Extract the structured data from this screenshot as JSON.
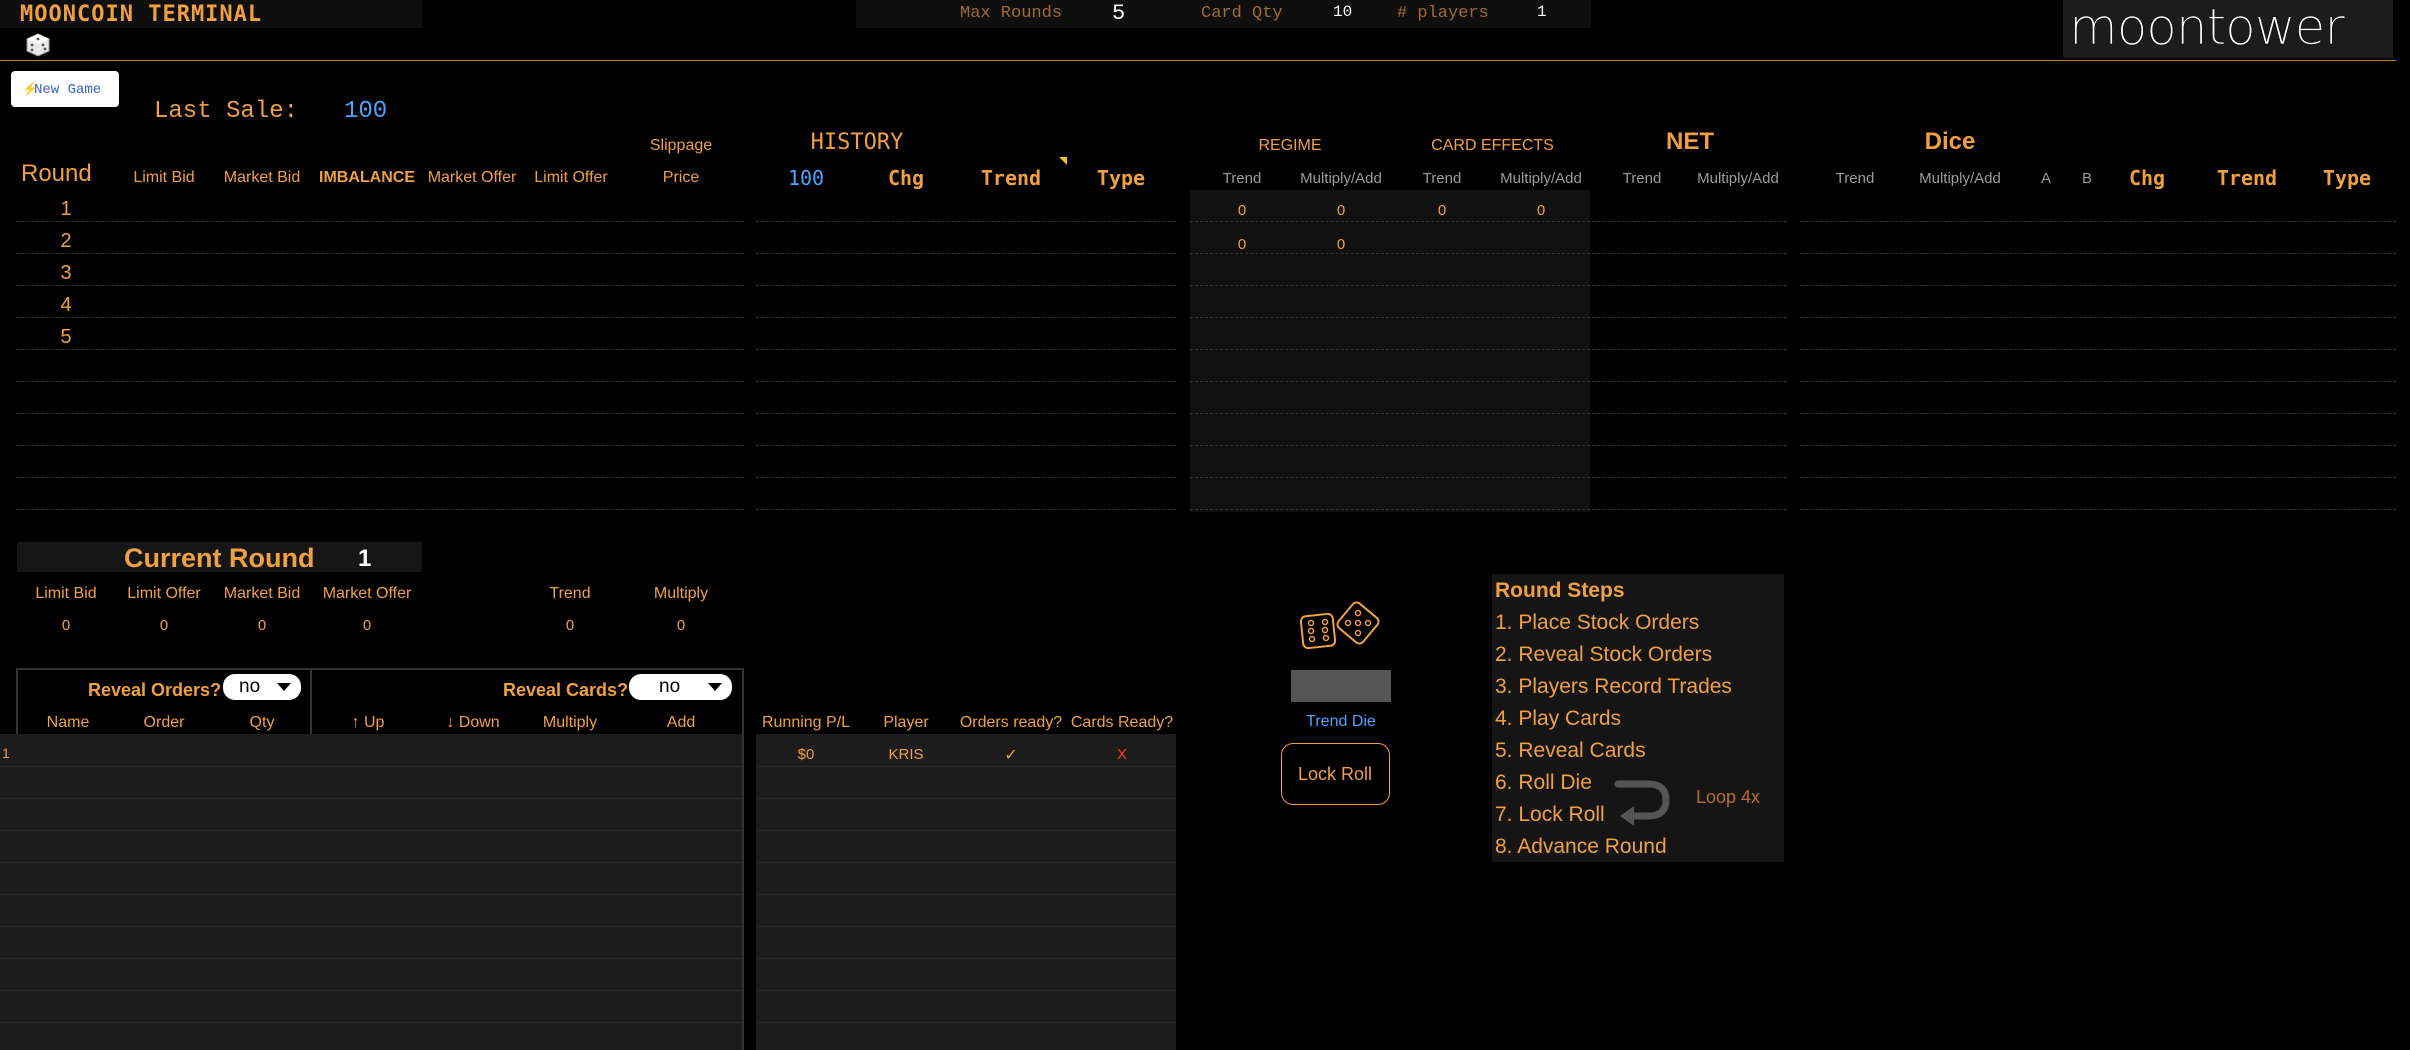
{
  "header": {
    "title": "MOONCOIN TERMINAL",
    "max_rounds_label": "Max Rounds",
    "max_rounds_value": "5",
    "card_qty_label": "Card Qty",
    "card_qty_value": "10",
    "players_label": "# players",
    "players_value": "1",
    "logo_text": "moontower"
  },
  "toolbar": {
    "new_game_label": "New Game",
    "last_sale_label": "Last Sale:",
    "last_sale_value": "100"
  },
  "table_headers": {
    "round": "Round",
    "limit_bid": "Limit Bid",
    "market_bid": "Market Bid",
    "imbalance": "IMBALANCE",
    "market_offer": "Market Offer",
    "limit_offer": "Limit Offer",
    "slippage": "Slippage",
    "price": "Price",
    "history": "HISTORY",
    "history_price": "100",
    "chg": "Chg",
    "trend": "Trend",
    "type": "Type",
    "regime": "REGIME",
    "card_effects": "CARD EFFECTS",
    "net": "NET",
    "dice": "Dice",
    "sub_trend": "Trend",
    "sub_multiply_add": "Multiply/Add",
    "a": "A",
    "b": "B"
  },
  "rounds": [
    "1",
    "2",
    "3",
    "4",
    "5"
  ],
  "regime_rows": [
    {
      "trend": "0",
      "mult": "0"
    },
    {
      "trend": "0",
      "mult": "0"
    }
  ],
  "card_effect_rows": [
    {
      "trend": "0",
      "mult": "0"
    }
  ],
  "current_round": {
    "label": "Current Round",
    "value": "1",
    "headers": {
      "limit_bid": "Limit Bid",
      "limit_offer": "Limit Offer",
      "market_bid": "Market Bid",
      "market_offer": "Market Offer",
      "trend": "Trend",
      "multiply": "Multiply"
    },
    "values": {
      "limit_bid": "0",
      "limit_offer": "0",
      "market_bid": "0",
      "market_offer": "0",
      "trend": "0",
      "multiply": "0"
    }
  },
  "orders": {
    "reveal_orders_label": "Reveal Orders?",
    "reveal_orders_value": "no",
    "reveal_cards_label": "Reveal Cards?",
    "reveal_cards_value": "no",
    "headers": {
      "name": "Name",
      "order": "Order",
      "qty": "Qty",
      "up": "↑ Up",
      "down": "↓ Down",
      "multiply": "Multiply",
      "add": "Add"
    },
    "row_index": "1"
  },
  "players": {
    "headers": {
      "running_pl": "Running P/L",
      "player": "Player",
      "orders_ready": "Orders ready?",
      "cards_ready": "Cards Ready?"
    },
    "rows": [
      {
        "pl": "$0",
        "player": "KRIS",
        "orders_ready": "✓",
        "cards_ready": "X"
      }
    ]
  },
  "dice_panel": {
    "trend_die_label": "Trend Die",
    "lock_roll_label": "Lock Roll"
  },
  "round_steps": {
    "title": "Round Steps",
    "steps": [
      "1. Place Stock Orders",
      "2. Reveal Stock Orders",
      "3. Players Record Trades",
      "4. Play Cards",
      "5. Reveal Cards",
      "6. Roll Die",
      "7. Lock Roll",
      "8. Advance Round"
    ],
    "loop_label": "Loop 4x"
  },
  "colors": {
    "accent": "#f0a040",
    "blue": "#4aa3ff",
    "red": "#ff3b2f",
    "background": "#000000"
  }
}
